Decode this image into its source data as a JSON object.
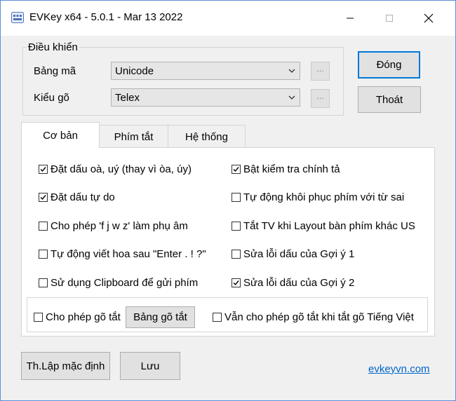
{
  "window": {
    "title": "EVKey x64 - 5.0.1 - Mar 13 2022"
  },
  "controls": {
    "group_label": "Điều khiển",
    "encoding_label": "Bảng mã",
    "encoding_value": "Unicode",
    "input_label": "Kiểu gõ",
    "input_value": "Telex",
    "more_label": "...",
    "close_button": "Đóng",
    "exit_button": "Thoát"
  },
  "tabs": [
    "Cơ bản",
    "Phím tắt",
    "Hệ thống"
  ],
  "options": [
    {
      "label": "Đặt dấu oà, uý (thay vì òa, úy)",
      "checked": true
    },
    {
      "label": "Bật kiểm tra chính tả",
      "checked": true
    },
    {
      "label": "Đặt dấu tự do",
      "checked": true
    },
    {
      "label": "Tự động khôi phục phím với từ sai",
      "checked": false
    },
    {
      "label": "Cho phép 'f j w z' làm phụ âm",
      "checked": false
    },
    {
      "label": "Tắt TV khi Layout bàn phím khác US",
      "checked": false
    },
    {
      "label": "Tự động viết hoa sau \"Enter . ! ?\"",
      "checked": false
    },
    {
      "label": "Sửa lỗi dấu của Gợi ý 1",
      "checked": false
    },
    {
      "label": "Sử dụng Clipboard để gửi phím",
      "checked": false
    },
    {
      "label": "Sửa lỗi dấu của Gợi ý 2",
      "checked": true
    }
  ],
  "shortcut": {
    "allow_label": "Cho phép gõ tắt",
    "allow_checked": false,
    "table_button": "Bảng gõ tắt",
    "keep_label": "Vẫn cho phép gõ tắt khi tắt gõ Tiếng Việt",
    "keep_checked": false
  },
  "footer": {
    "default_button": "Th.Lập mặc định",
    "save_button": "Lưu",
    "link": "evkeyvn.com"
  }
}
